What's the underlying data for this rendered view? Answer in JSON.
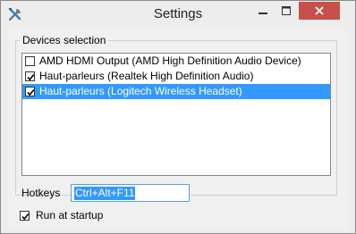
{
  "window": {
    "title": "Settings",
    "controls": [
      "minimize-icon",
      "maximize-icon",
      "close-icon"
    ],
    "close_color": "#c7504a"
  },
  "devices": {
    "group_label": "Devices selection",
    "items": [
      {
        "label": "AMD HDMI Output (AMD High Definition Audio Device)",
        "checked": false,
        "selected": false
      },
      {
        "label": "Haut-parleurs (Realtek High Definition Audio)",
        "checked": true,
        "selected": false
      },
      {
        "label": "Haut-parleurs (Logitech Wireless Headset)",
        "checked": true,
        "selected": true
      }
    ],
    "selection_color": "#3399ff"
  },
  "hotkeys": {
    "label": "Hotkeys",
    "value": "Ctrl+Alt+F11"
  },
  "startup": {
    "label": "Run at startup",
    "checked": true
  }
}
